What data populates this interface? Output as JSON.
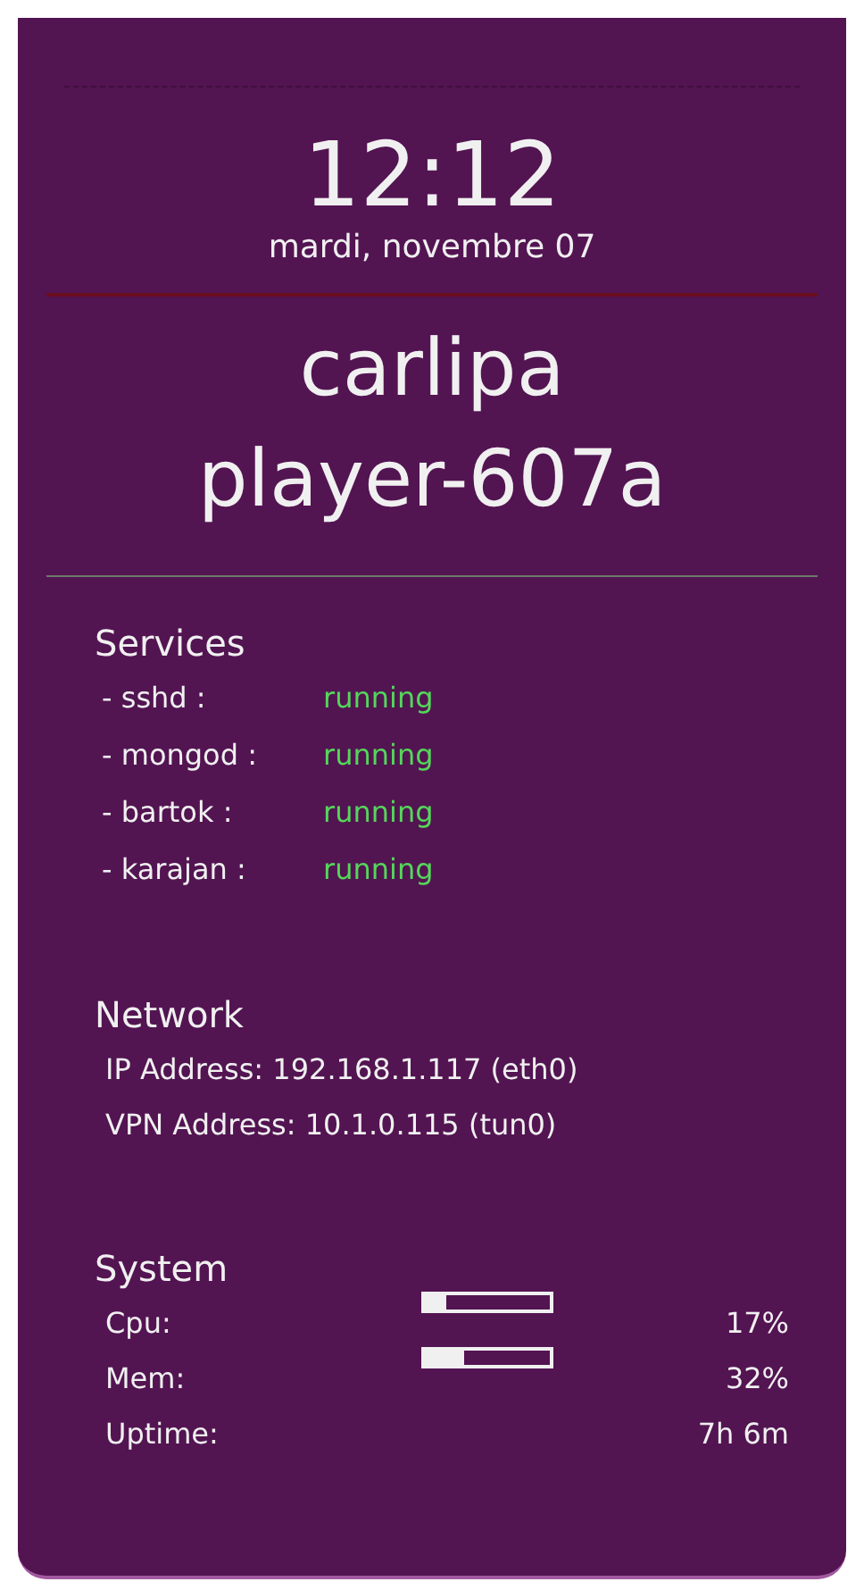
{
  "clock": {
    "time": "12:12",
    "date": "mardi, novembre 07"
  },
  "host": {
    "lines": [
      "carlipa",
      "player-607a"
    ]
  },
  "services": {
    "title": "Services",
    "items": [
      {
        "name": "- sshd :",
        "status": "running"
      },
      {
        "name": "- mongod :",
        "status": "running"
      },
      {
        "name": "- bartok :",
        "status": "running"
      },
      {
        "name": "- karajan :",
        "status": "running"
      }
    ]
  },
  "network": {
    "title": "Network",
    "lines": [
      "IP Address: 192.168.1.117 (eth0)",
      "VPN Address: 10.1.0.115 (tun0)"
    ]
  },
  "system": {
    "title": "System",
    "rows": [
      {
        "kind": "meter",
        "label": "Cpu:",
        "level": 0.17,
        "reading": "17%"
      },
      {
        "kind": "meter",
        "label": "Mem:",
        "level": 0.32,
        "reading": "32%"
      },
      {
        "kind": "text",
        "label": "Uptime:",
        "reading": "7h 6m"
      }
    ]
  }
}
